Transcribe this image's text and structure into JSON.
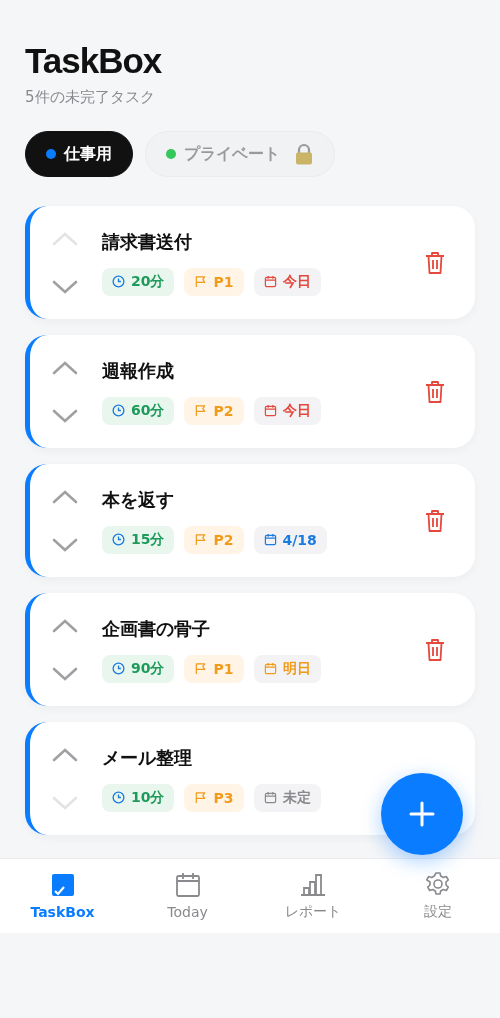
{
  "header": {
    "title": "TaskBox",
    "subtitle": "5件の未完了タスク"
  },
  "filters": [
    {
      "label": "仕事用",
      "color": "#0a7cff",
      "selected": true,
      "locked": false
    },
    {
      "label": "プライベート",
      "color": "#34c759",
      "selected": false,
      "locked": true
    }
  ],
  "tasks": [
    {
      "title": "請求書送付",
      "duration": "20分",
      "priority": "P1",
      "due": "今日",
      "color": "#e5483d",
      "up_disabled": true,
      "down_disabled": false,
      "trash": true
    },
    {
      "title": "週報作成",
      "duration": "60分",
      "priority": "P2",
      "due": "今日",
      "color": "#e5483d",
      "up_disabled": false,
      "down_disabled": false,
      "trash": true
    },
    {
      "title": "本を返す",
      "duration": "15分",
      "priority": "P2",
      "due": "4/18",
      "color": "#1a7be0",
      "up_disabled": false,
      "down_disabled": false,
      "trash": true
    },
    {
      "title": "企画書の骨子",
      "duration": "90分",
      "priority": "P1",
      "due": "明日",
      "color": "#f29a1a",
      "up_disabled": false,
      "down_disabled": false,
      "trash": true
    },
    {
      "title": "メール整理",
      "duration": "10分",
      "priority": "P3",
      "due": "未定",
      "color": "#8a8a8e",
      "up_disabled": false,
      "down_disabled": true,
      "trash": false
    }
  ],
  "tab_bar": [
    {
      "label": "TaskBox",
      "kind": "tasks",
      "selected": true
    },
    {
      "label": "Today",
      "kind": "calendar",
      "selected": false
    },
    {
      "label": "レポート",
      "kind": "report",
      "selected": false
    },
    {
      "label": "設定",
      "kind": "settings",
      "selected": false
    }
  ]
}
